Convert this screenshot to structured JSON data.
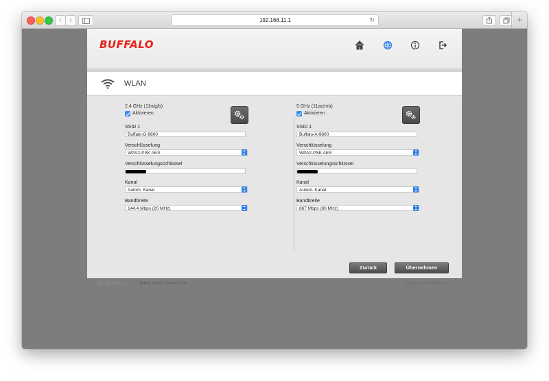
{
  "browser": {
    "url": "192.168.11.1",
    "new_tab": "+"
  },
  "header": {
    "logo": "BUFFALO",
    "icons": [
      "home-icon",
      "globe-icon",
      "info-icon",
      "logout-icon"
    ],
    "accent_color": "#e8201b",
    "active_icon_color": "#2f7fe6"
  },
  "section": {
    "title": "WLAN",
    "icon": "wifi-icon"
  },
  "bands": [
    {
      "band_label": "2.4 GHz (11n/g/b)",
      "enable_label": "Aktivieren",
      "enabled": true,
      "ssid_label": "SSID 1",
      "ssid_value": "Buffalo-G-9800",
      "encryption_label": "Verschlüsselung",
      "encryption_value": "WPA2-PSK AES",
      "key_label": "Verschlüsselungsschlüssel",
      "channel_label": "Kanal",
      "channel_value": "Autom. Kanal",
      "bandwidth_label": "Bandbreite",
      "bandwidth_value": "144.4 Mbps (20 MHz)"
    },
    {
      "band_label": "5 GHz (11ac/n/a)",
      "enable_label": "Aktivieren",
      "enabled": true,
      "ssid_label": "SSID 1",
      "ssid_value": "Buffalo-A-9800",
      "encryption_label": "Verschlüsselung",
      "encryption_value": "WPA2-PSK AES",
      "key_label": "Verschlüsselungsschlüssel",
      "channel_label": "Kanal",
      "channel_value": "Autom. Kanal",
      "bandwidth_label": "Bandbreite",
      "bandwidth_value": "867 Mbps (80 MHz)"
    }
  ],
  "actions": {
    "back_label": "Zurück",
    "apply_label": "Übernehmen"
  },
  "footer": {
    "brand": "AirStation",
    "version": "WHR-1166D Version 1.60",
    "copyright": "Copyright © 2014 Buffalo Inc."
  }
}
